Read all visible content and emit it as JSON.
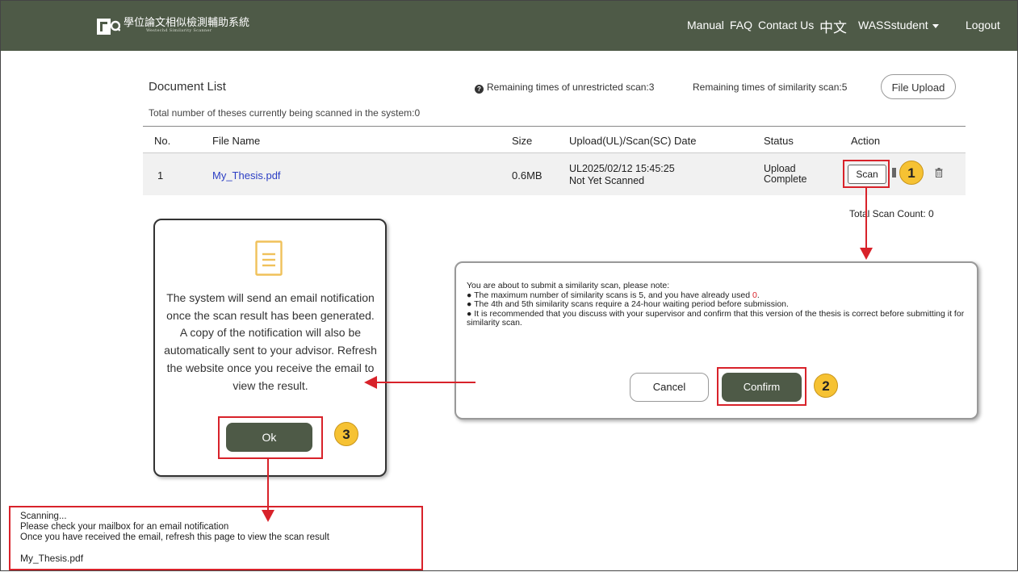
{
  "header": {
    "logo_title": "學位論文相似檢測輔助系統",
    "logo_subtitle": "Westechd Similarity Scanner",
    "nav": {
      "manual": "Manual",
      "faq": "FAQ",
      "contact": "Contact Us",
      "language": "中文",
      "user": "WASSstudent",
      "logout": "Logout"
    },
    "bg_color": "#4e5a47"
  },
  "document_list": {
    "title": "Document List",
    "total_theses": "Total number of theses currently being scanned in the system:0",
    "remaining_unrestricted": "Remaining times of unrestricted scan:3",
    "remaining_similarity": "Remaining times of similarity scan:5",
    "upload_button": "File Upload",
    "columns": {
      "no": "No.",
      "file_name": "File Name",
      "size": "Size",
      "date": "Upload(UL)/Scan(SC) Date",
      "status": "Status",
      "action": "Action"
    },
    "rows": [
      {
        "no": "1",
        "file_name": "My_Thesis.pdf",
        "size": "0.6MB",
        "upload_date": "UL2025/02/12 15:45:25",
        "scan_date": "Not Yet Scanned",
        "status_line1": "Upload",
        "status_line2": "Complete",
        "action_scan": "Scan"
      }
    ],
    "total_scan_count": "Total Scan Count: 0"
  },
  "steps": {
    "step1": "1",
    "step2": "2",
    "step3": "3"
  },
  "notification_dialog": {
    "icon": "document-icon",
    "message": "The system will send an email notification once the scan result has been generated. A copy of the notification will also be automatically sent to your advisor. Refresh the website once you receive the email to view the result.",
    "ok_button": "Ok"
  },
  "confirm_dialog": {
    "intro": "You are about to submit a similarity scan, please note:",
    "note1_prefix": "● The maximum number of similarity scans is 5, and you have already used ",
    "note1_used": "0",
    "note1_suffix": ".",
    "note2": "● The 4th and 5th similarity scans require a 24-hour waiting period before submission.",
    "note3": "● It is recommended that you discuss with your supervisor and confirm that this version of the thesis is correct before submitting it for similarity scan.",
    "cancel_button": "Cancel",
    "confirm_button": "Confirm"
  },
  "scanning_notice": {
    "line1": "Scanning...",
    "line2": "Please check your mailbox for an email notification",
    "line3": "Once you have received the email, refresh this page to view the scan result",
    "file": "My_Thesis.pdf"
  },
  "colors": {
    "accent_green": "#4e5a47",
    "highlight_red": "#d8222a",
    "badge_yellow": "#f6c233",
    "link_blue": "#2b3ec4"
  }
}
